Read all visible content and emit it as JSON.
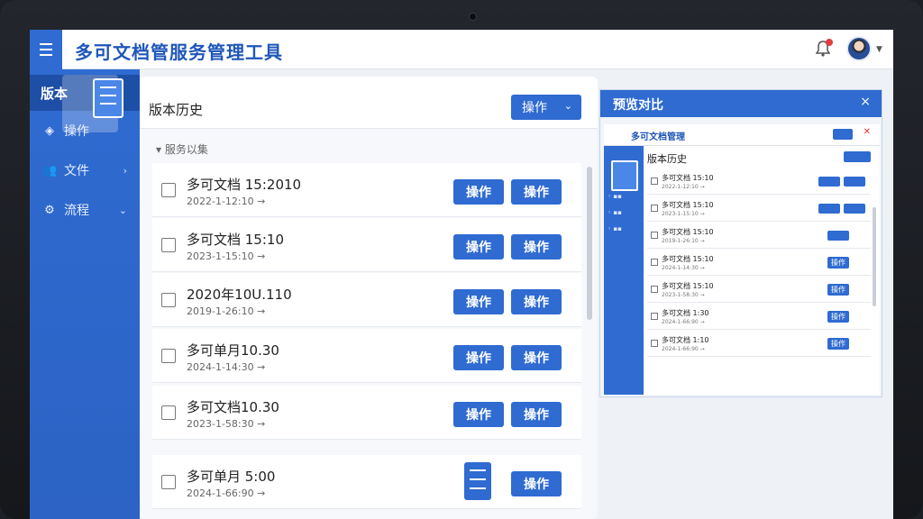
{
  "app": {
    "title": "多可文档管服务管理工具"
  },
  "header": {
    "notification_icon": "bell-icon",
    "avatar_icon": "user-avatar"
  },
  "sidebar": {
    "items": [
      {
        "label": "版本",
        "icon": "document-icon",
        "active": true
      },
      {
        "label": "操作",
        "icon": "cube-icon"
      },
      {
        "label": "文件",
        "icon": "users-icon"
      },
      {
        "label": "流程",
        "icon": "flow-icon"
      }
    ]
  },
  "main": {
    "title": "版本历史",
    "action_dropdown": "操作",
    "filter_label": "▾ 服务以集",
    "rows": [
      {
        "name": "多可文档 15:2010",
        "date": "2022-1-12:10 →",
        "btn1": "操作",
        "btn2": "操作"
      },
      {
        "name": "多可文档 15:10",
        "date": "2023-1-15:10 →",
        "btn1": "操作",
        "btn2": "操作"
      },
      {
        "name": "2020年10U.110",
        "date": "2019-1-26:10 →",
        "btn1": "操作",
        "btn2": "操作"
      },
      {
        "name": "多可单月10.30",
        "date": "2024-1-14:30 →",
        "btn1": "操作",
        "btn2": "操作"
      },
      {
        "name": "多可文档10.30",
        "date": "2023-1-58:30 →",
        "btn1": "操作",
        "btn2": "操作"
      },
      {
        "name": "多可单月 5:00",
        "date": "2024-1-66:90 →",
        "btn1": "",
        "btn2": "操作"
      }
    ]
  },
  "preview": {
    "title": "预览对比",
    "close": "×",
    "inner_title": "多可文档管理",
    "inner_heading": "版本历史",
    "inner_rows": [
      {
        "name": "多可文档 15:10",
        "date": "2022-1-12:10 →"
      },
      {
        "name": "多可文档 15:10",
        "date": "2023-1-15:10 →"
      },
      {
        "name": "多可文档 15:10",
        "date": "2019-1-26:10 →"
      },
      {
        "name": "多可文档 15:10",
        "date": "2024-1-14:30 →"
      },
      {
        "name": "多可文档 15:10",
        "date": "2023-1-58:30 →"
      },
      {
        "name": "多可文档 1:30",
        "date": "2024-1-66:90 →"
      },
      {
        "name": "多可文档 1:10",
        "date": "2024-1-66:90 →"
      }
    ],
    "inner_button": "操作"
  },
  "colors": {
    "accent": "#2f6bd1",
    "title": "#1f56b8",
    "badge": "#e23c3c"
  }
}
